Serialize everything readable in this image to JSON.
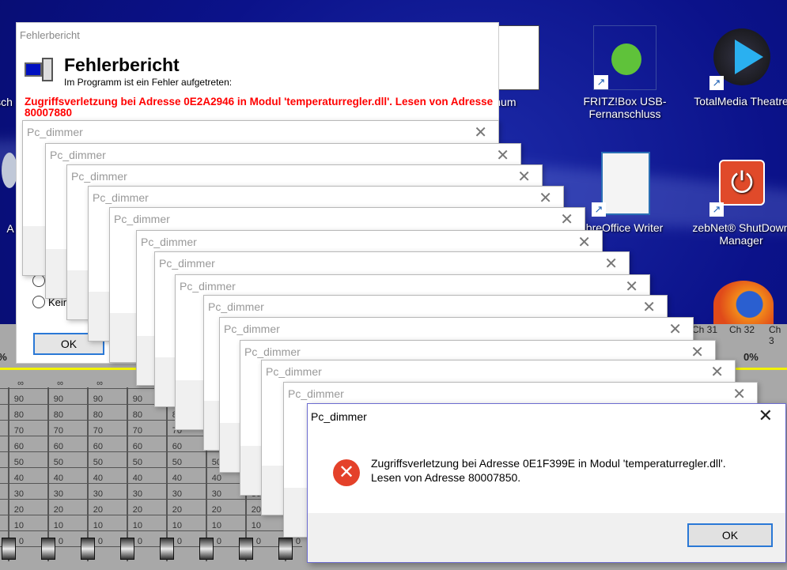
{
  "desktop": {
    "icons": [
      {
        "label": "FRITZ!Box USB-Fernanschluss",
        "icon": "usb-plug-icon"
      },
      {
        "label": "TotalMedia Theatre",
        "icon": "play-orb-icon"
      },
      {
        "label": "ibreOffice Writer",
        "icon": "writer-document-icon"
      },
      {
        "label": "zebNet® ShutDown Manager",
        "icon": "power-icon"
      },
      {
        "label": "enum",
        "icon": "document-icon"
      },
      {
        "label": "sch",
        "icon": ""
      },
      {
        "label": "A",
        "icon": "cd-icon"
      }
    ]
  },
  "mixer": {
    "channels_right": [
      "Ch 31",
      "Ch 32",
      "Ch 3"
    ],
    "percent": "0%",
    "scale": [
      "∞",
      "90",
      "80",
      "70",
      "60",
      "50",
      "40",
      "30",
      "20",
      "10",
      "0"
    ],
    "levels_percent": [
      0,
      0,
      0,
      0,
      0,
      0,
      0,
      0
    ]
  },
  "fehlerbericht": {
    "title": "Fehlerbericht",
    "heading": "Fehlerbericht",
    "subtitle": "Im Programm ist ein Fehler aufgetreten:",
    "error": "Zugriffsverletzung bei Adresse 0E2A2946 in Modul 'temperaturregler.dll'. Lesen von Adresse 80007880",
    "radio_label": "Kein",
    "ok": "OK"
  },
  "stacked_dialogs": {
    "title": "Pc_dimmer",
    "count": 13
  },
  "dialog": {
    "title": "Pc_dimmer",
    "message_line1": "Zugriffsverletzung bei Adresse 0E1F399E in Modul 'temperaturregler.dll'.",
    "message_line2": "Lesen von Adresse 80007850.",
    "ok": "OK",
    "close": "✕",
    "icon": "error-icon"
  },
  "colors": {
    "desktop": "#0b128a",
    "error_red": "#e4412a",
    "accent": "#2a78d6",
    "mixer": "#a8a8a8",
    "level_line": "#f2f200"
  }
}
